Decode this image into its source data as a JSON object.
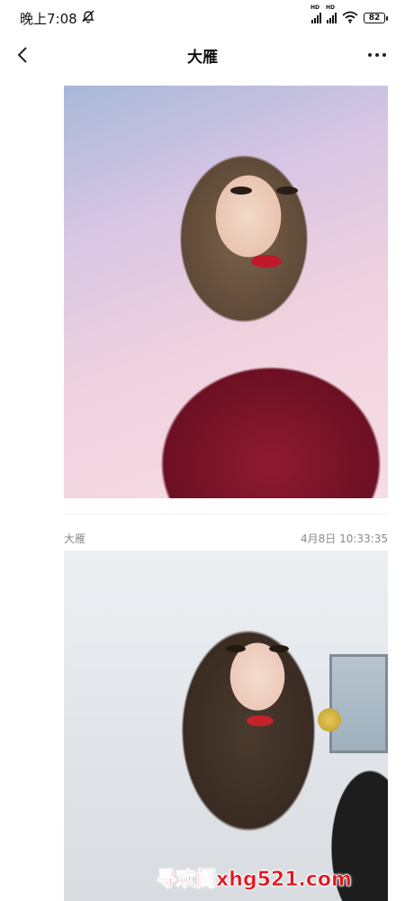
{
  "status_bar": {
    "time": "晚上7:08",
    "network_label_1": "HD",
    "network_label_2": "HD",
    "battery": "82",
    "icons": [
      "mute-icon",
      "signal-icon",
      "signal-icon",
      "wifi-icon",
      "battery-icon"
    ]
  },
  "nav": {
    "title": "大雁",
    "back_icon": "chevron-left-icon",
    "more_icon": "more-horizontal-icon"
  },
  "posts": [
    {
      "image_alt": "photo"
    },
    {
      "author": "大雁",
      "timestamp": "4月8日 10:33:35",
      "image_alt": "photo"
    }
  ],
  "watermark": "寻欢阁xhg521.com"
}
